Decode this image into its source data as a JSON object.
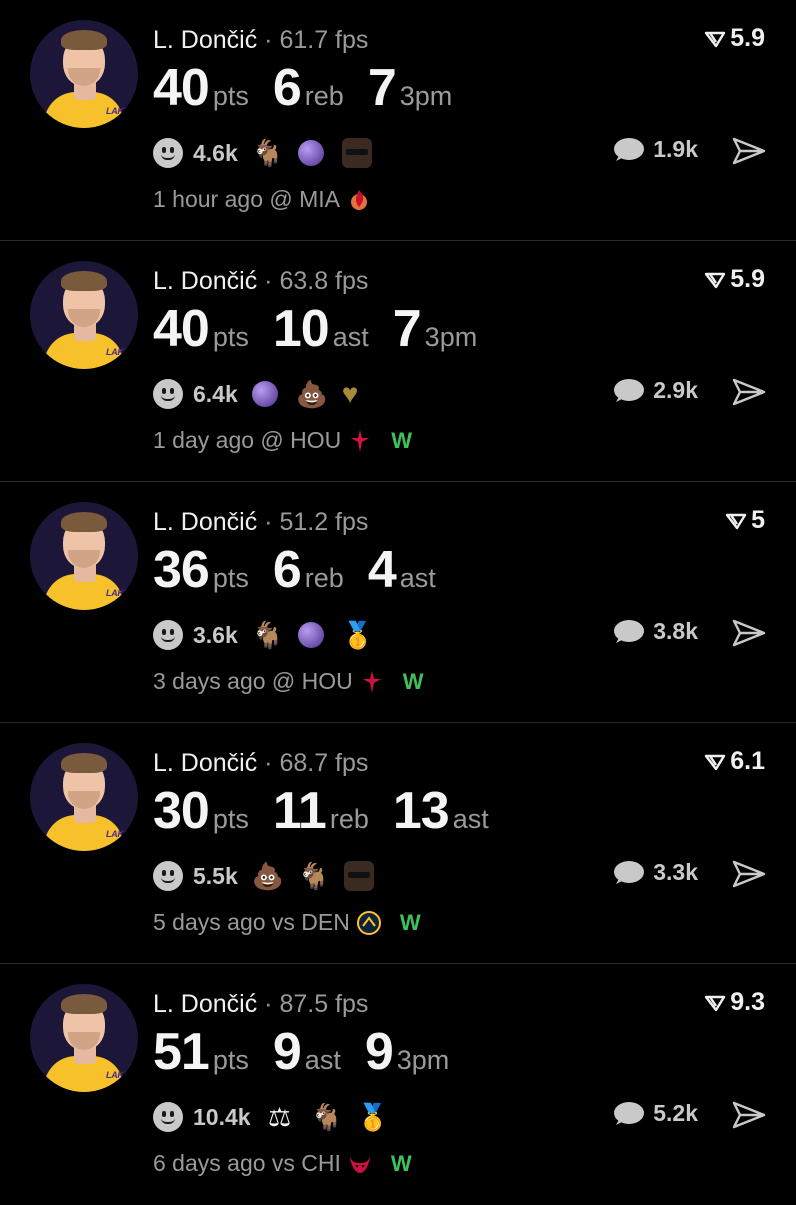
{
  "posts": [
    {
      "name": "L. Dončić",
      "fps": "61.7 fps",
      "score": "5.9",
      "stats": [
        {
          "value": "40",
          "label": "pts"
        },
        {
          "value": "6",
          "label": "reb"
        },
        {
          "value": "7",
          "label": "3pm"
        }
      ],
      "reaction_count": "4.6k",
      "reaction_icons": [
        "goat-icon",
        "crystal-ball-icon",
        "sunglasses-face-icon"
      ],
      "reply_count": "1.9k",
      "meta": "1 hour ago @ MIA",
      "opponent_logo": "heat-logo-icon",
      "result": ""
    },
    {
      "name": "L. Dončić",
      "fps": "63.8 fps",
      "score": "5.9",
      "stats": [
        {
          "value": "40",
          "label": "pts"
        },
        {
          "value": "10",
          "label": "ast"
        },
        {
          "value": "7",
          "label": "3pm"
        }
      ],
      "reaction_count": "6.4k",
      "reaction_icons": [
        "crystal-ball-icon",
        "poop-icon",
        "gold-heart-icon"
      ],
      "reply_count": "2.9k",
      "meta": "1 day ago @ HOU",
      "opponent_logo": "rockets-logo-icon",
      "result": "W"
    },
    {
      "name": "L. Dončić",
      "fps": "51.2 fps",
      "score": "5",
      "stats": [
        {
          "value": "36",
          "label": "pts"
        },
        {
          "value": "6",
          "label": "reb"
        },
        {
          "value": "4",
          "label": "ast"
        }
      ],
      "reaction_count": "3.6k",
      "reaction_icons": [
        "goat-icon",
        "crystal-ball-icon",
        "medal-icon"
      ],
      "reply_count": "3.8k",
      "meta": "3 days ago @ HOU",
      "opponent_logo": "rockets-logo-icon",
      "result": "W"
    },
    {
      "name": "L. Dončić",
      "fps": "68.7 fps",
      "score": "6.1",
      "stats": [
        {
          "value": "30",
          "label": "pts"
        },
        {
          "value": "11",
          "label": "reb"
        },
        {
          "value": "13",
          "label": "ast"
        }
      ],
      "reaction_count": "5.5k",
      "reaction_icons": [
        "poop-icon",
        "goat-icon",
        "sunglasses-face-icon"
      ],
      "reply_count": "3.3k",
      "meta": "5 days ago vs DEN",
      "opponent_logo": "nuggets-logo-icon",
      "result": "W"
    },
    {
      "name": "L. Dončić",
      "fps": "87.5 fps",
      "score": "9.3",
      "stats": [
        {
          "value": "51",
          "label": "pts"
        },
        {
          "value": "9",
          "label": "ast"
        },
        {
          "value": "9",
          "label": "3pm"
        }
      ],
      "reaction_count": "10.4k",
      "reaction_icons": [
        "scales-icon",
        "goat-icon",
        "medal-icon"
      ],
      "reply_count": "5.2k",
      "meta": "6 days ago vs CHI",
      "opponent_logo": "bulls-logo-icon",
      "result": "W"
    }
  ],
  "colors": {
    "background": "#000000",
    "text_primary": "#f2f2f2",
    "text_secondary": "#9a9a9a",
    "win_green": "#3fc15a",
    "divider": "#2a2a2a"
  }
}
